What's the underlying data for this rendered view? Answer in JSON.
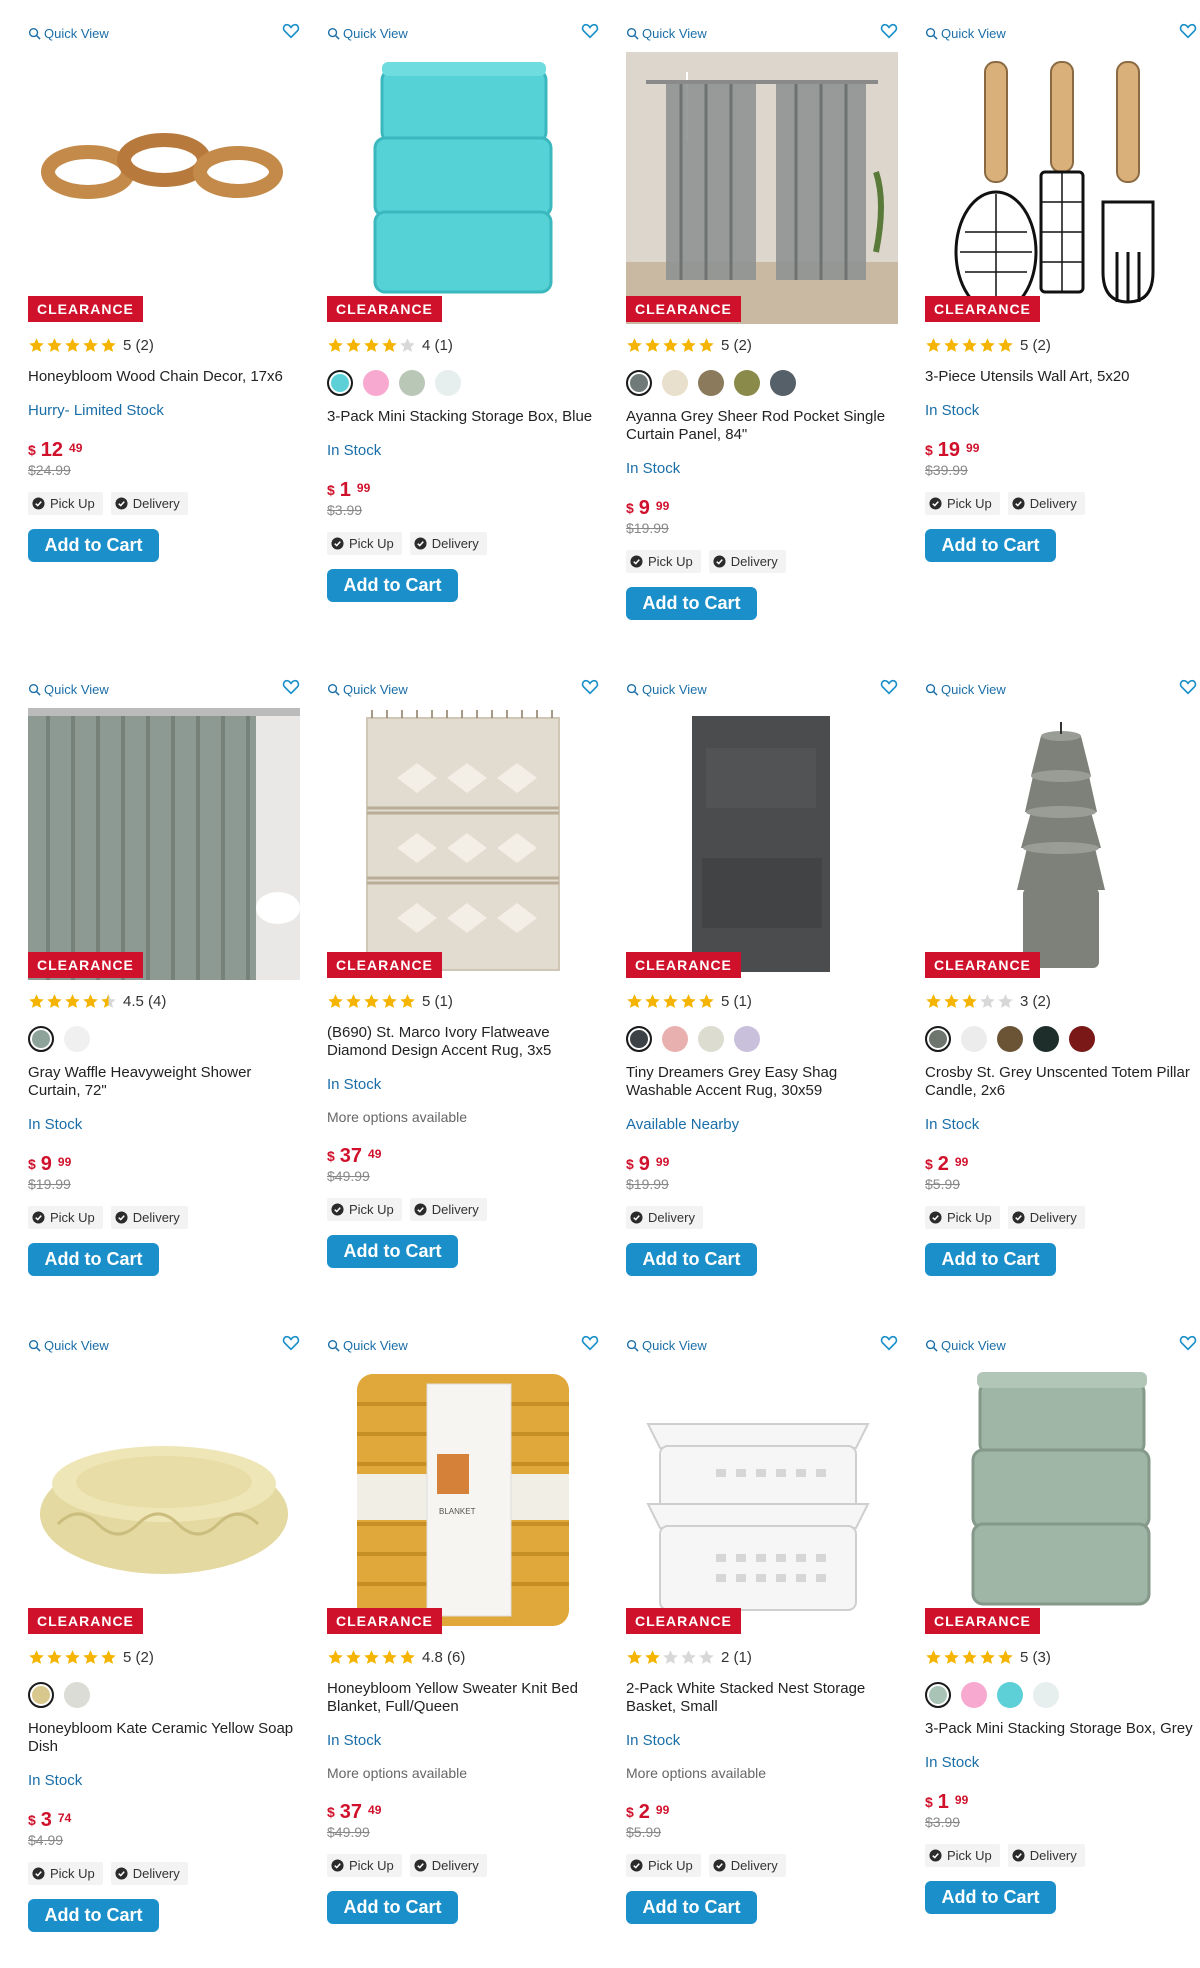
{
  "colors": {
    "badge": "#d0112b",
    "accent": "#1a8fc9",
    "link": "#1a6ea8",
    "price": "#d0112b",
    "star": "#f5b400"
  },
  "products": [
    {
      "quick_view": "Quick View",
      "badge": "CLEARANCE",
      "stars": 5,
      "rating_text": "5 (2)",
      "swatches": [],
      "title": "Honeybloom Wood Chain Decor, 17x6",
      "stock": "Hurry- Limited Stock",
      "more": "",
      "price_cur": "$",
      "price_dollars": "12",
      "price_cents": "49",
      "was": "$24.99",
      "fulfillment": [
        "Pick Up",
        "Delivery"
      ],
      "button": "Add to Cart",
      "image": "wood-chain"
    },
    {
      "quick_view": "Quick View",
      "badge": "CLEARANCE",
      "stars": 4,
      "rating_text": "4 (1)",
      "swatches": [
        "#5cd0d6",
        "#f7a9cf",
        "#b9c7b6",
        "#e6eeee"
      ],
      "title": "3-Pack Mini Stacking Storage Box, Blue",
      "stock": "In Stock",
      "more": "",
      "price_cur": "$",
      "price_dollars": "1",
      "price_cents": "99",
      "was": "$3.99",
      "fulfillment": [
        "Pick Up",
        "Delivery"
      ],
      "button": "Add to Cart",
      "image": "blue-boxes"
    },
    {
      "quick_view": "Quick View",
      "badge": "CLEARANCE",
      "stars": 5,
      "rating_text": "5 (2)",
      "swatches": [
        "#707a78",
        "#e8e0cc",
        "#8b7a5c",
        "#8a8a4a",
        "#556068"
      ],
      "title": "Ayanna Grey Sheer Rod Pocket Single Curtain Panel, 84\"",
      "stock": "In Stock",
      "more": "",
      "price_cur": "$",
      "price_dollars": "9",
      "price_cents": "99",
      "was": "$19.99",
      "fulfillment": [
        "Pick Up",
        "Delivery"
      ],
      "button": "Add to Cart",
      "image": "curtain"
    },
    {
      "quick_view": "Quick View",
      "badge": "CLEARANCE",
      "stars": 5,
      "rating_text": "5 (2)",
      "swatches": [],
      "title": "3-Piece Utensils Wall Art, 5x20",
      "stock": "In Stock",
      "more": "",
      "price_cur": "$",
      "price_dollars": "19",
      "price_cents": "99",
      "was": "$39.99",
      "fulfillment": [
        "Pick Up",
        "Delivery"
      ],
      "button": "Add to Cart",
      "image": "utensils"
    },
    {
      "quick_view": "Quick View",
      "badge": "CLEARANCE",
      "stars": 4.5,
      "rating_text": "4.5 (4)",
      "swatches": [
        "#8ea39a",
        "#f0f0f0"
      ],
      "title": "Gray Waffle Heavyweight Shower Curtain, 72\"",
      "stock": "In Stock",
      "more": "",
      "price_cur": "$",
      "price_dollars": "9",
      "price_cents": "99",
      "was": "$19.99",
      "fulfillment": [
        "Pick Up",
        "Delivery"
      ],
      "button": "Add to Cart",
      "image": "shower-curtain"
    },
    {
      "quick_view": "Quick View",
      "badge": "CLEARANCE",
      "stars": 5,
      "rating_text": "5 (1)",
      "swatches": [],
      "title": "(B690) St. Marco Ivory Flatweave Diamond Design Accent Rug, 3x5",
      "stock": "In Stock",
      "more": "More options available",
      "price_cur": "$",
      "price_dollars": "37",
      "price_cents": "49",
      "was": "$49.99",
      "fulfillment": [
        "Pick Up",
        "Delivery"
      ],
      "button": "Add to Cart",
      "image": "ivory-rug"
    },
    {
      "quick_view": "Quick View",
      "badge": "CLEARANCE",
      "stars": 5,
      "rating_text": "5 (1)",
      "swatches": [
        "#3c4246",
        "#e8b0ae",
        "#dcdcd0",
        "#c9c0dc"
      ],
      "title": "Tiny Dreamers Grey Easy Shag Washable Accent Rug, 30x59",
      "stock": "Available Nearby",
      "more": "",
      "price_cur": "$",
      "price_dollars": "9",
      "price_cents": "99",
      "was": "$19.99",
      "fulfillment": [
        "Delivery"
      ],
      "button": "Add to Cart",
      "image": "grey-rug"
    },
    {
      "quick_view": "Quick View",
      "badge": "CLEARANCE",
      "stars": 3,
      "rating_text": "3 (2)",
      "swatches": [
        "#6e756e",
        "#ececec",
        "#6b5436",
        "#1e2e2a",
        "#7a1818"
      ],
      "title": "Crosby St. Grey Unscented Totem Pillar Candle, 2x6",
      "stock": "In Stock",
      "more": "",
      "price_cur": "$",
      "price_dollars": "2",
      "price_cents": "99",
      "was": "$5.99",
      "fulfillment": [
        "Pick Up",
        "Delivery"
      ],
      "button": "Add to Cart",
      "image": "candle"
    },
    {
      "quick_view": "Quick View",
      "badge": "CLEARANCE",
      "stars": 5,
      "rating_text": "5 (2)",
      "swatches": [
        "#d9c88d",
        "#dcdcd6"
      ],
      "title": "Honeybloom Kate Ceramic Yellow Soap Dish",
      "stock": "In Stock",
      "more": "",
      "price_cur": "$",
      "price_dollars": "3",
      "price_cents": "74",
      "was": "$4.99",
      "fulfillment": [
        "Pick Up",
        "Delivery"
      ],
      "button": "Add to Cart",
      "image": "soap-dish"
    },
    {
      "quick_view": "Quick View",
      "badge": "CLEARANCE",
      "stars": 4.8,
      "rating_text": "4.8 (6)",
      "swatches": [],
      "title": "Honeybloom Yellow Sweater Knit Bed Blanket, Full/Queen",
      "stock": "In Stock",
      "more": "More options available",
      "price_cur": "$",
      "price_dollars": "37",
      "price_cents": "49",
      "was": "$49.99",
      "fulfillment": [
        "Pick Up",
        "Delivery"
      ],
      "button": "Add to Cart",
      "image": "blanket"
    },
    {
      "quick_view": "Quick View",
      "badge": "CLEARANCE",
      "stars": 2,
      "rating_text": "2 (1)",
      "swatches": [],
      "title": "2-Pack White Stacked Nest Storage Basket, Small",
      "stock": "In Stock",
      "more": "More options available",
      "price_cur": "$",
      "price_dollars": "2",
      "price_cents": "99",
      "was": "$5.99",
      "fulfillment": [
        "Pick Up",
        "Delivery"
      ],
      "button": "Add to Cart",
      "image": "baskets"
    },
    {
      "quick_view": "Quick View",
      "badge": "CLEARANCE",
      "stars": 5,
      "rating_text": "5 (3)",
      "swatches": [
        "#a9c4b6",
        "#f7a9cf",
        "#5cd0d6",
        "#e6eeee"
      ],
      "title": "3-Pack Mini Stacking Storage Box, Grey",
      "stock": "In Stock",
      "more": "",
      "price_cur": "$",
      "price_dollars": "1",
      "price_cents": "99",
      "was": "$3.99",
      "fulfillment": [
        "Pick Up",
        "Delivery"
      ],
      "button": "Add to Cart",
      "image": "grey-boxes"
    }
  ]
}
